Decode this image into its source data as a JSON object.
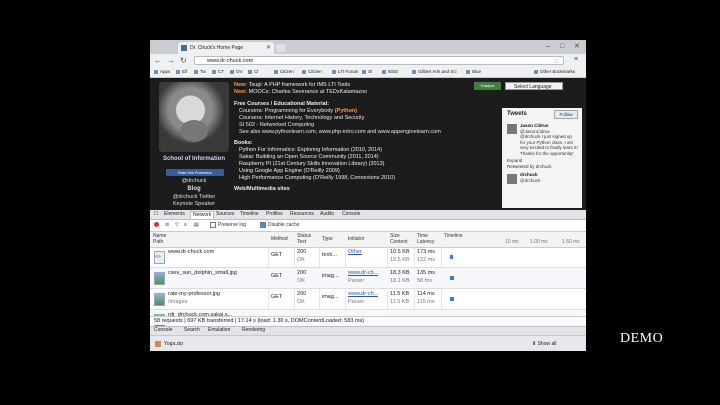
{
  "browser": {
    "tab_title": "Dr. Chuck's Home Page",
    "url": "www.dr-chuck.com",
    "bookmarks": [
      "Apps",
      "Ell",
      "Tw",
      "CT",
      "OV",
      "Cl",
      "Citizen",
      "Citizen",
      "LTI Forum",
      "SI",
      "IEEE",
      "Gilbert Arts and Sci",
      "Blue",
      "Other Bookmarks"
    ]
  },
  "page": {
    "sidebar": {
      "school": "School of Information",
      "rate_button": "Rate this Professor",
      "twitter_handle": "@drchuck",
      "blog": "Blog",
      "drchuck_twitter": "@drchuck Twitter",
      "keynote": "Keynote Speaker"
    },
    "news": [
      {
        "label": "New:",
        "text": "Tsugi: A PHP framework for IMS LTI Tools"
      },
      {
        "label": "New:",
        "text": "MOOCs: Charles Severance at TEDxKalamazoo"
      }
    ],
    "courses_heading": "Free Courses / Educational Material:",
    "courses": [
      {
        "pre": "Coursera: Programming for Everybody ",
        "hl": "(Python)"
      },
      {
        "pre": "Coursera: Internet History, Technology and Security",
        "hl": ""
      },
      {
        "pre": "SI 502 - Networked Computing",
        "hl": ""
      },
      {
        "pre": "See also www.pythonlearn.com, www.php-intro.com and www.appenginelearn.com",
        "hl": ""
      }
    ],
    "books_heading": "Books:",
    "books": [
      "Python For Informatics: Exploring Information (2010, 2014)",
      "Sakai: Building an Open Source Community (2011, 2014)",
      "Raspberry PI (21st Century Skills Innovation Library) (2013)",
      "Using Google App Engine (O'Reilly 2009)",
      "High Performance Computing (O'Reilly 1998, Connexions 2010)"
    ],
    "media_heading": "Web/Multimedia sites",
    "language_select": "Select Language",
    "gradepic_button": "Gradpic",
    "tweets": {
      "heading": "Tweets",
      "follow": "Follow",
      "items": [
        {
          "name": "Jason Cidrus",
          "handle": "@JasonCidrus",
          "time": "4h",
          "text": "@drchuck I just signed up for your Python class. I am very excited to finally learn it! Thanks for the opportunity!"
        },
        {
          "name": "drchuck",
          "handle": "@drchuck",
          "time": "",
          "text": "Retweeted by drchuck"
        }
      ],
      "expand": "Expand"
    }
  },
  "devtools": {
    "tabs": [
      "Elements",
      "Network",
      "Sources",
      "Timeline",
      "Profiles",
      "Resources",
      "Audits",
      "Console"
    ],
    "active_tab": "Network",
    "toolbar": {
      "preserve_log": "Preserve log",
      "disable_cache": "Disable cache"
    },
    "columns": {
      "name": "Name",
      "path": "Path",
      "method": "Method",
      "status": "Status",
      "status_text": "Text",
      "type": "Type",
      "initiator": "Initiator",
      "size": "Size",
      "content": "Content",
      "time": "Time",
      "latency": "Latency",
      "timeline": "Timeline",
      "ticks": [
        "10 ms",
        "1.00 ms",
        "1.50 ms"
      ]
    },
    "rows": [
      {
        "name": "www.dr-chuck.com",
        "path": "",
        "method": "GET",
        "status": "200",
        "status_text": "OK",
        "type": "text/...",
        "initiator": "Other",
        "initiator_sub": "",
        "size": "10.5 KB",
        "content": "10.5 KB",
        "time": "173 ms",
        "latency": "122 ms",
        "icon": "html"
      },
      {
        "name": "csev_sun_dolphin_small.jpg",
        "path": "",
        "method": "GET",
        "status": "200",
        "status_text": "OK",
        "type": "imag...",
        "initiator": "www.dr-ch...",
        "initiator_sub": "Parser",
        "size": "18.3 KB",
        "content": "18.1 KB",
        "time": "135 ms",
        "latency": "58 ms",
        "icon": "img"
      },
      {
        "name": "rate-my-professor.jpg",
        "path": "/images",
        "method": "GET",
        "status": "200",
        "status_text": "OK",
        "type": "imag...",
        "initiator": "www.dr-ch...",
        "initiator_sub": "Parser",
        "size": "11.5 KB",
        "content": "11.5 KB",
        "time": "114 ms",
        "latency": "115 ms",
        "icon": "img"
      },
      {
        "name": "rdr_drchuck.com.sakai.s...",
        "path": "",
        "method": "",
        "status": "",
        "status_text": "",
        "type": "",
        "initiator": "",
        "initiator_sub": "",
        "size": "",
        "content": "",
        "time": "",
        "latency": "",
        "icon": "img"
      }
    ],
    "status_bar": "58 requests | 697 KB transferred | 17.14 s (load: 1.30 s, DOMContentLoaded: 583 ms)",
    "drawer_tabs": [
      "Console",
      "Search",
      "Emulation",
      "Rendering"
    ]
  },
  "downloads": {
    "item": "Yoga.zip",
    "show_all": "Show all"
  },
  "slide": {
    "caption": "DEMO"
  }
}
